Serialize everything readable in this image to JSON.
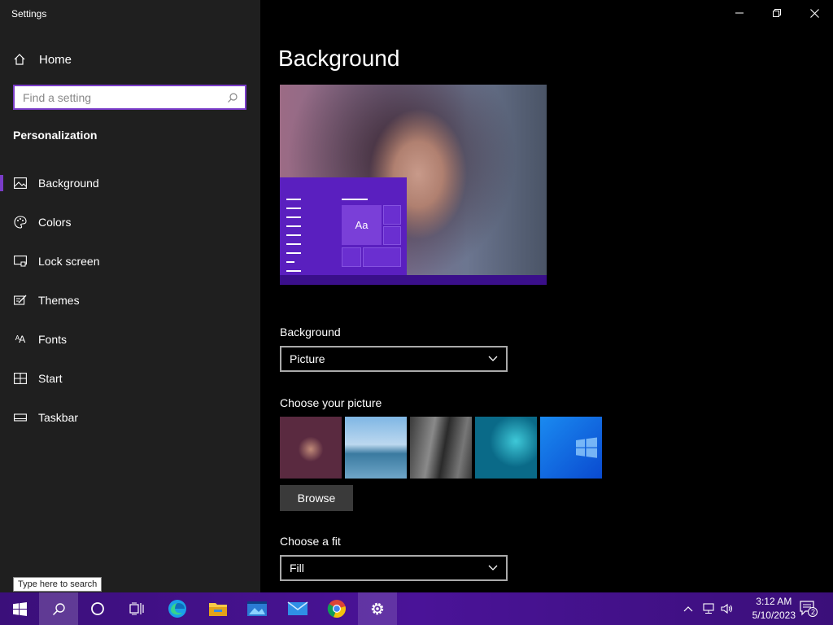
{
  "window": {
    "title": "Settings"
  },
  "sidebar": {
    "home_label": "Home",
    "search_placeholder": "Find a setting",
    "section_title": "Personalization",
    "items": [
      {
        "label": "Background",
        "icon": "picture-icon",
        "active": true
      },
      {
        "label": "Colors",
        "icon": "palette-icon",
        "active": false
      },
      {
        "label": "Lock screen",
        "icon": "lock-screen-icon",
        "active": false
      },
      {
        "label": "Themes",
        "icon": "themes-icon",
        "active": false
      },
      {
        "label": "Fonts",
        "icon": "fonts-icon",
        "active": false
      },
      {
        "label": "Start",
        "icon": "start-icon",
        "active": false
      },
      {
        "label": "Taskbar",
        "icon": "taskbar-icon",
        "active": false
      }
    ]
  },
  "main": {
    "title": "Background",
    "preview": {
      "tile_text": "Aa"
    },
    "background_label": "Background",
    "background_value": "Picture",
    "choose_picture_label": "Choose your picture",
    "browse_label": "Browse",
    "fit_label": "Choose a fit",
    "fit_value": "Fill"
  },
  "taskbar": {
    "search_tooltip": "Type here to search",
    "time": "3:12 AM",
    "date": "5/10/2023",
    "notification_count": "2",
    "accent": "#4a1398"
  },
  "colors": {
    "accent": "#7a3cc8",
    "sidebar_bg": "#1f1f1f",
    "main_bg": "#000000"
  }
}
